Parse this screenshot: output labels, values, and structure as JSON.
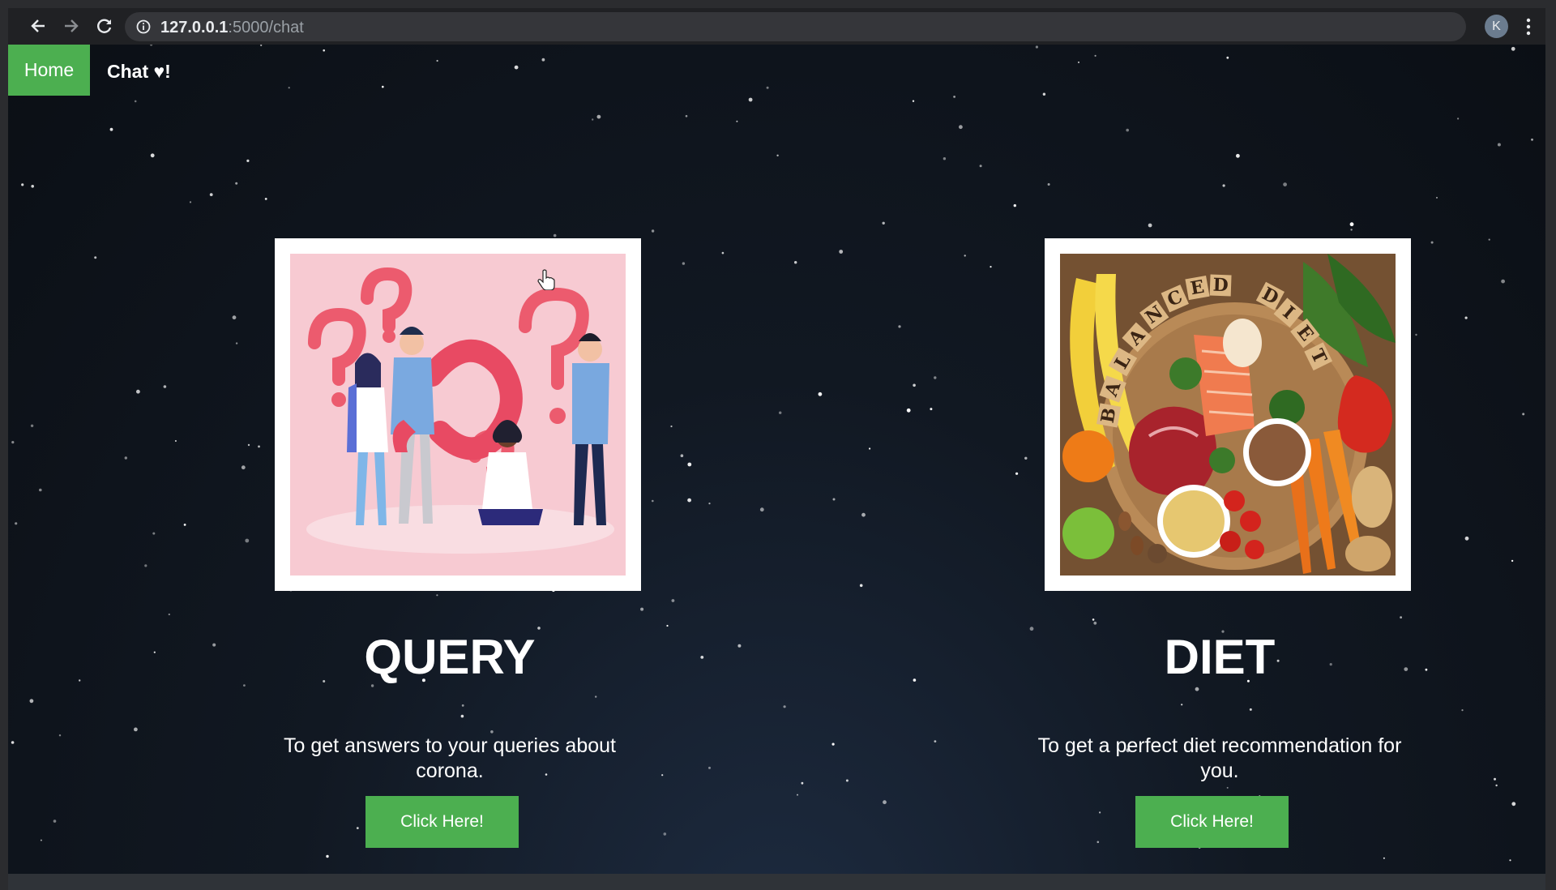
{
  "browser": {
    "url_host": "127.0.0.1",
    "url_path": ":5000/chat",
    "profile_initial": "K",
    "icons": [
      "back-arrow-icon",
      "forward-arrow-icon",
      "reload-icon",
      "info-icon",
      "star-icon",
      "kebab-menu-icon"
    ]
  },
  "navbar": {
    "home_label": "Home",
    "chat_label": "Chat ♥!"
  },
  "cards": [
    {
      "title": "QUERY",
      "description": "To get answers to your queries about corona.",
      "button_label": "Click Here!"
    },
    {
      "title": "DIET",
      "description": "To get a perfect diet recommendation for you.",
      "button_label": "Click Here!"
    }
  ],
  "colors": {
    "accent_green": "#4caf50",
    "page_background": "#0f151e",
    "chrome_background": "#202124"
  }
}
